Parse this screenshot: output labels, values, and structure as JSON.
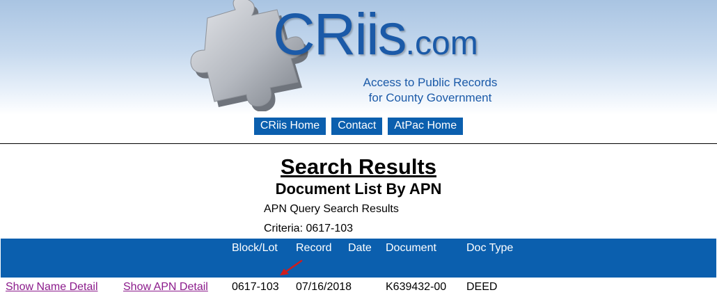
{
  "logo": {
    "brand": "CRiis",
    "tld": ".com",
    "tagline_line1": "Access to Public Records",
    "tagline_line2": "for County Government"
  },
  "nav": {
    "items": [
      "CRiis Home",
      "Contact",
      "AtPac Home"
    ]
  },
  "page": {
    "title": "Search Results",
    "subtitle": "Document List By APN",
    "query_info": "APN Query Search Results",
    "criteria": "Criteria: 0617-103"
  },
  "table": {
    "headers": [
      "Block/Lot",
      "Record",
      "Date",
      "Document",
      "Doc Type"
    ],
    "rows": [
      {
        "name_link": "Show Name Detail",
        "apn_link": "Show APN Detail",
        "block_lot": "0617-103",
        "record_date": "07/16/2018",
        "document": "K639432-00",
        "doc_type": "DEED"
      }
    ]
  },
  "colors": {
    "brand_blue": "#1b5aa8",
    "nav_blue": "#0b5fae",
    "visited_link": "#8b1a8b",
    "annotation_arrow": "#d01c1c"
  }
}
